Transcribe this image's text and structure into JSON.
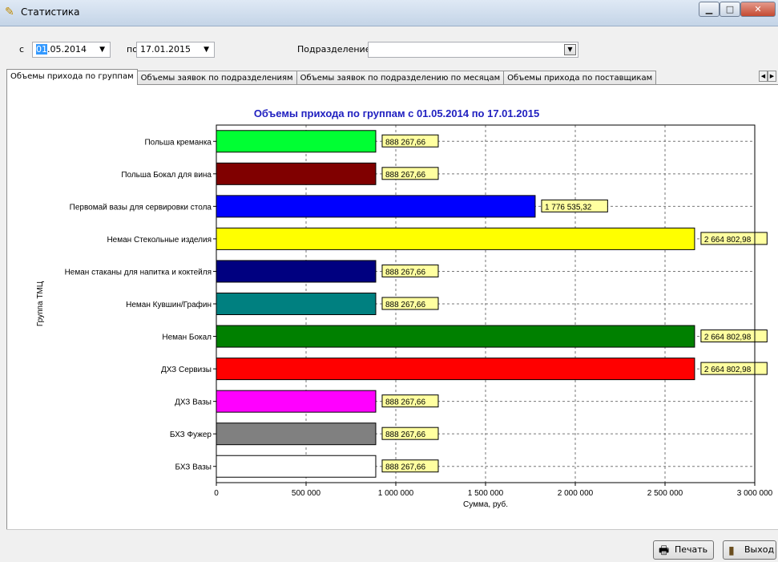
{
  "window": {
    "title": "Статистика",
    "icon": "app-icon",
    "controls": [
      "minimize",
      "maximize",
      "close"
    ]
  },
  "filters": {
    "from_label": "с",
    "from_selected": "01",
    "from_value": ".05.2014",
    "to_label": "по",
    "to_value": "17.01.2015",
    "dept_label": "Подразделение:",
    "dept_value": ""
  },
  "tabs": [
    "Объемы прихода по группам",
    "Объемы заявок по подразделениям",
    "Объемы заявок по подразделению по месяцам",
    "Объемы прихода по поставщикам"
  ],
  "buttons": {
    "print": "Печать",
    "exit": "Выход"
  },
  "chart_data": {
    "type": "bar",
    "orientation": "horizontal",
    "title": "Объемы прихода по группам с 01.05.2014 по 17.01.2015",
    "xlabel": "Сумма, руб.",
    "ylabel": "Группа ТМЦ",
    "xlim": [
      0,
      3000000
    ],
    "x_ticks": [
      0,
      500000,
      1000000,
      1500000,
      2000000,
      2500000,
      3000000
    ],
    "x_tick_labels": [
      "0",
      "500 000",
      "1 000 000",
      "1 500 000",
      "2 000 000",
      "2 500 000",
      "3 000 000"
    ],
    "grid": true,
    "categories": [
      "Польша креманка",
      "Польша Бокал для вина",
      "Первомай вазы для сервировки стола",
      "Неман Стекольные изделия",
      "Неман стаканы для напитка и коктейля",
      "Неман Кувшин/Графин",
      "Неман Бокал",
      "ДХЗ Сервизы",
      "ДХЗ Вазы",
      "БХЗ Фужер",
      "БХЗ Вазы"
    ],
    "values": [
      888267.66,
      888267.66,
      1776535.32,
      2664802.98,
      888267.66,
      888267.66,
      2664802.98,
      2664802.98,
      888267.66,
      888267.66,
      888267.66
    ],
    "value_labels": [
      "888 267,66",
      "888 267,66",
      "1 776 535,32",
      "2 664 802,98",
      "888 267,66",
      "888 267,66",
      "2 664 802,98",
      "2 664 802,98",
      "888 267,66",
      "888 267,66",
      "888 267,66"
    ],
    "colors": [
      "#00ff33",
      "#800000",
      "#0000ff",
      "#ffff00",
      "#000080",
      "#008080",
      "#008000",
      "#ff0000",
      "#ff00ff",
      "#808080",
      "#ffffff"
    ]
  }
}
